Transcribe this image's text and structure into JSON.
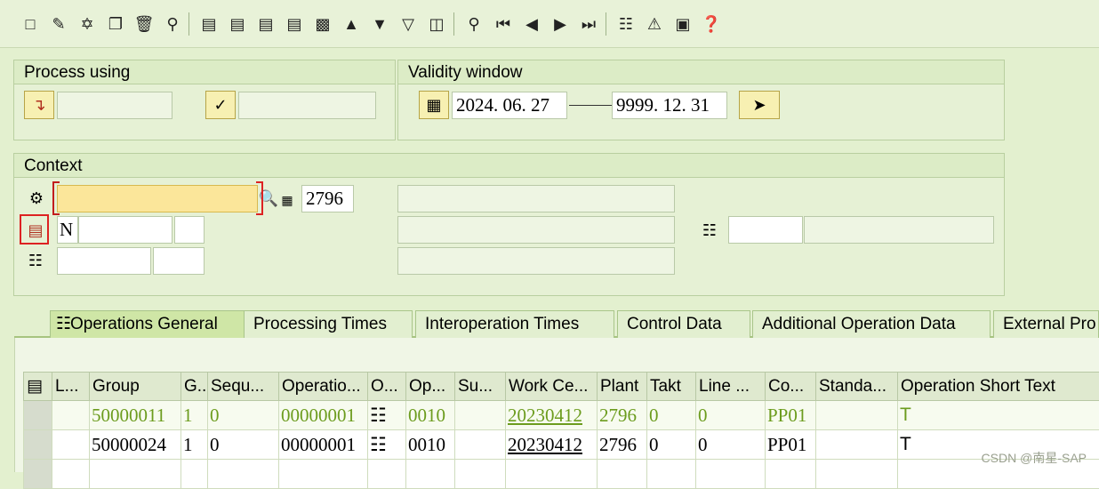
{
  "toolbar": {
    "icons": [
      "new-icon",
      "edit-icon",
      "copy-icon",
      "clipboard-icon",
      "delete-icon",
      "where-used-icon",
      "details-icon",
      "select-all-icon",
      "deselect-icon",
      "sort-icon",
      "add-line-icon",
      "filter-icon",
      "filter-alt-icon",
      "column-icon",
      "find-icon",
      "first-page-icon",
      "prev-page-icon",
      "next-page-icon",
      "last-page-icon",
      "hierarchy-icon",
      "alert-icon",
      "object-icon",
      "help-icon"
    ]
  },
  "process_using": {
    "title": "Process using",
    "field1": "",
    "field2": ""
  },
  "validity": {
    "title": "Validity window",
    "from": "2024. 06. 27",
    "to": "9999. 12. 31"
  },
  "context": {
    "title": "Context",
    "material": "",
    "plant": "2796",
    "type": "N",
    "group": "",
    "counter": "",
    "seq1": "",
    "seq2": ""
  },
  "tabs": [
    {
      "label": "Operations General"
    },
    {
      "label": "Processing Times"
    },
    {
      "label": "Interoperation Times"
    },
    {
      "label": "Control Data"
    },
    {
      "label": "Additional Operation Data"
    },
    {
      "label": "External Pro"
    }
  ],
  "table": {
    "headers": [
      "L...",
      "Group",
      "G...",
      "Sequ...",
      "Operatio...",
      "O...",
      "Op...",
      "Su...",
      "Work Ce...",
      "Plant",
      "Takt",
      "Line ...",
      "Co...",
      "Standa...",
      "Operation Short Text"
    ],
    "rows": [
      {
        "group": "50000011",
        "g": "1",
        "seq": "0",
        "operation": "00000001",
        "op": "0010",
        "su": "",
        "workcenter": "20230412",
        "plant": "2796",
        "takt": "0",
        "line": "0",
        "co": "PP01",
        "standard": "",
        "shorttext": "T"
      },
      {
        "group": "50000024",
        "g": "1",
        "seq": "0",
        "operation": "00000001",
        "op": "0010",
        "su": "",
        "workcenter": "20230412",
        "plant": "2796",
        "takt": "0",
        "line": "0",
        "co": "PP01",
        "standard": "",
        "shorttext": "T"
      }
    ]
  },
  "watermark": "CSDN @南星-SAP"
}
